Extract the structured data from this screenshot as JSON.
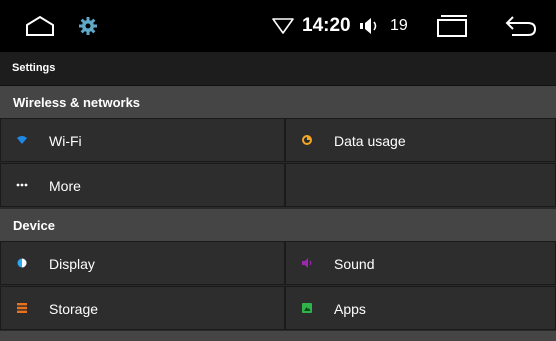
{
  "statusbar": {
    "time": "14:20",
    "volume_level": "19",
    "icons": [
      "home-icon",
      "gear-icon",
      "wifi-signal-icon",
      "volume-icon",
      "recents-icon",
      "back-icon"
    ]
  },
  "title": "Settings",
  "sections": [
    {
      "title": "Wireless & networks",
      "items": [
        {
          "label": "Wi-Fi",
          "icon": "wifi-icon",
          "color": "#1e88e5"
        },
        {
          "label": "Data usage",
          "icon": "data-usage-icon",
          "color": "#f5a623"
        },
        {
          "label": "More",
          "icon": "more-icon",
          "color": "#ffffff"
        }
      ]
    },
    {
      "title": "Device",
      "items": [
        {
          "label": "Display",
          "icon": "display-icon",
          "color": "#29a9f0"
        },
        {
          "label": "Sound",
          "icon": "sound-icon",
          "color": "#9c27b0"
        },
        {
          "label": "Storage",
          "icon": "storage-icon",
          "color": "#e8731c"
        },
        {
          "label": "Apps",
          "icon": "apps-icon",
          "color": "#2fb34a"
        }
      ]
    }
  ]
}
